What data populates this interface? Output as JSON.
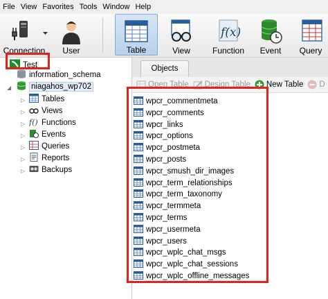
{
  "menubar": {
    "items": [
      "File",
      "View",
      "Favorites",
      "Tools",
      "Window",
      "Help"
    ]
  },
  "toolbar": {
    "buttons": [
      {
        "label": "Connection",
        "icon": "connection-icon"
      },
      {
        "label": "User",
        "icon": "user-icon"
      },
      {
        "label": "Table",
        "icon": "table-icon",
        "active": true
      },
      {
        "label": "View",
        "icon": "view-icon"
      },
      {
        "label": "Function",
        "icon": "function-icon"
      },
      {
        "label": "Event",
        "icon": "event-icon"
      },
      {
        "label": "Query",
        "icon": "query-icon"
      }
    ]
  },
  "tree": {
    "connection": "Test",
    "databases": [
      "information_schema",
      "niagahos_wp702"
    ],
    "groups": [
      "Tables",
      "Views",
      "Functions",
      "Events",
      "Queries",
      "Reports",
      "Backups"
    ]
  },
  "tabs": {
    "objects": "Objects"
  },
  "object_toolbar": {
    "open_table": "Open Table",
    "design_table": "Design Table",
    "new_table": "New Table",
    "delete_table": "D"
  },
  "tables": [
    "wpcr_commentmeta",
    "wpcr_comments",
    "wpcr_links",
    "wpcr_options",
    "wpcr_postmeta",
    "wpcr_posts",
    "wpcr_smush_dir_images",
    "wpcr_term_relationships",
    "wpcr_term_taxonomy",
    "wpcr_termmeta",
    "wpcr_terms",
    "wpcr_usermeta",
    "wpcr_users",
    "wpcr_wplc_chat_msgs",
    "wpcr_wplc_chat_sessions",
    "wpcr_wplc_offline_messages"
  ],
  "colors": {
    "highlight": "#e2231a",
    "selection": "#e3ecf7",
    "toolbar_active": "#c9dcf0"
  }
}
